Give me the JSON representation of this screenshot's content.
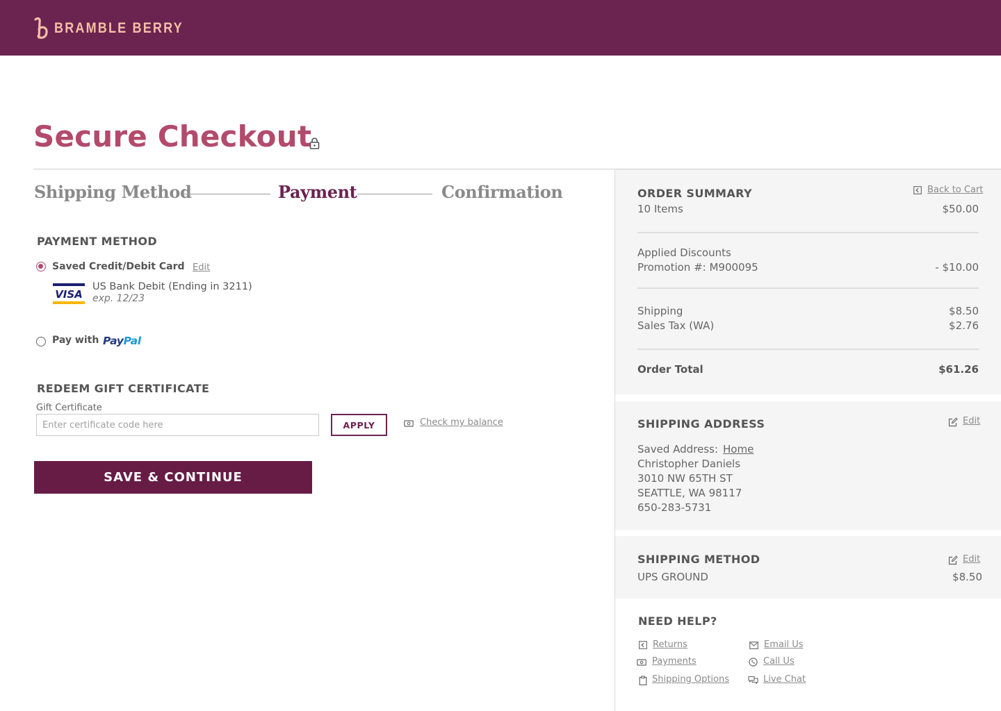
{
  "brand": {
    "name": "BRAMBLE BERRY"
  },
  "colors": {
    "brand_purple": "#6b2350",
    "accent_pink": "#b34a6c",
    "logo_peach": "#f4bfa6",
    "button_purple": "#671c46",
    "paypal_dark": "#253b80",
    "paypal_light": "#179bd7"
  },
  "page": {
    "title": "Secure Checkout"
  },
  "steps": [
    {
      "label": "Shipping Method",
      "state": "done"
    },
    {
      "label": "Payment",
      "state": "active"
    },
    {
      "label": "Confirmation",
      "state": "pending"
    }
  ],
  "payment_method": {
    "heading": "PAYMENT METHOD",
    "saved_card": {
      "label": "Saved Credit/Debit Card",
      "edit_label": "Edit",
      "selected": true,
      "card_brand": "VISA",
      "card_name": "US Bank Debit  (Ending in 3211)",
      "expiry": "exp. 12/23"
    },
    "paypal": {
      "label": "Pay with",
      "pay": "Pay",
      "pal": "Pal",
      "selected": false
    }
  },
  "gift_certificate": {
    "heading": "REDEEM GIFT CERTIFICATE",
    "field_label": "Gift Certificate",
    "placeholder": "Enter certificate code here",
    "value": "",
    "apply_label": "APPLY",
    "balance_link": "Check my balance"
  },
  "save_button": "SAVE & CONTINUE",
  "order_summary": {
    "heading": "ORDER SUMMARY",
    "back_link": "Back to Cart",
    "items_label": "10 Items",
    "items_value": "$50.00",
    "discounts_label": "Applied Discounts",
    "promotion_label": "Promotion #: M900095",
    "promotion_value": "- $10.00",
    "shipping_label": "Shipping",
    "shipping_value": "$8.50",
    "tax_label": "Sales Tax (WA)",
    "tax_value": "$2.76",
    "total_label": "Order Total",
    "total_value": "$61.26"
  },
  "shipping_address": {
    "heading": "SHIPPING ADDRESS",
    "edit_label": "Edit",
    "saved_label": "Saved Address:",
    "saved_name": "Home",
    "name": "Christopher Daniels",
    "street": "3010 NW 65TH ST",
    "city": "SEATTLE, WA 98117",
    "phone": "650-283-5731"
  },
  "shipping_method": {
    "heading": "SHIPPING METHOD",
    "edit_label": "Edit",
    "method": "UPS GROUND",
    "price": "$8.50"
  },
  "help": {
    "heading": "NEED HELP?",
    "links": {
      "returns": "Returns",
      "payments": "Payments",
      "shipping_options": "Shipping Options",
      "email": "Email Us",
      "call": "Call Us",
      "chat": "Live Chat"
    }
  }
}
